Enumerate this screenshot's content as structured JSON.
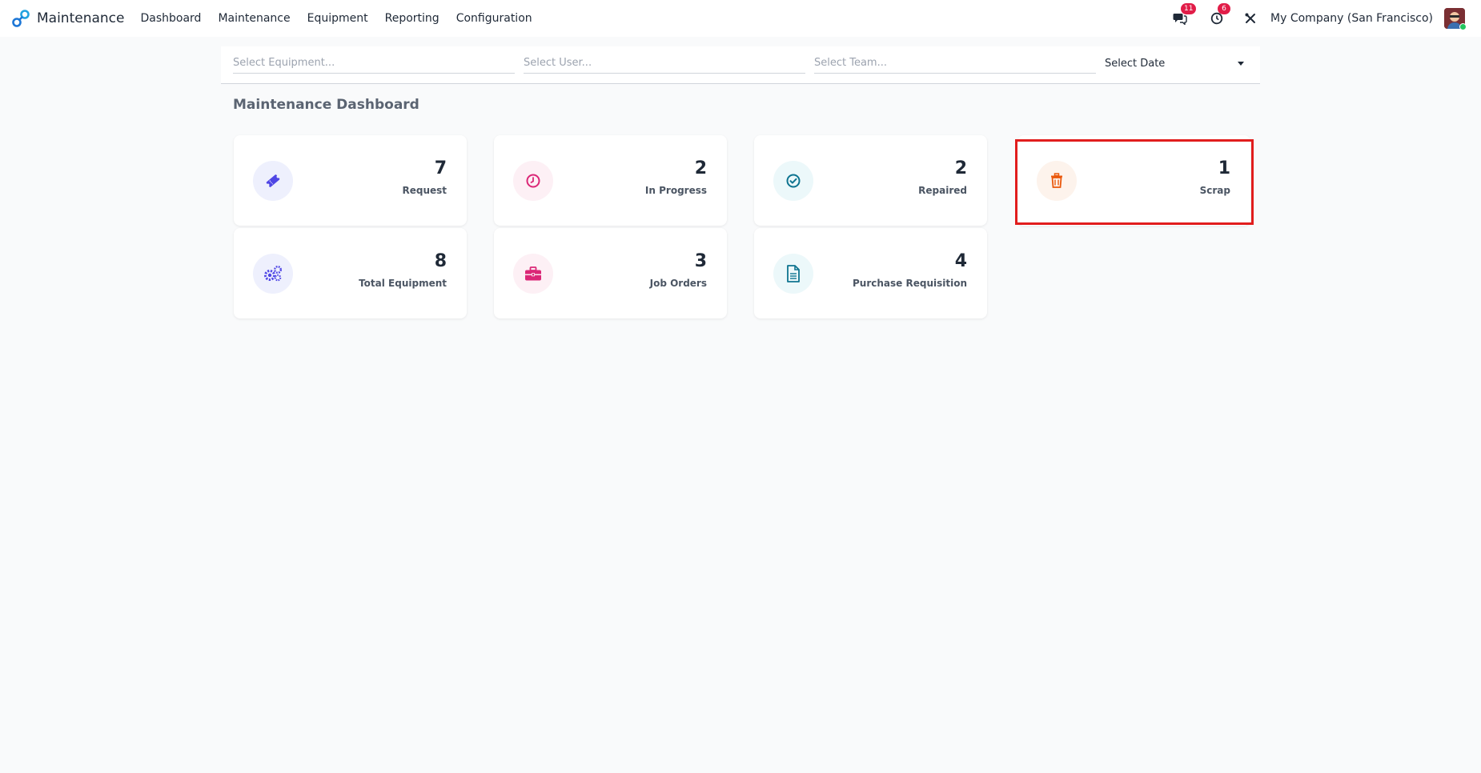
{
  "app": {
    "name": "Maintenance"
  },
  "nav": {
    "items": [
      {
        "label": "Dashboard"
      },
      {
        "label": "Maintenance"
      },
      {
        "label": "Equipment"
      },
      {
        "label": "Reporting"
      },
      {
        "label": "Configuration"
      }
    ],
    "messages_badge": "11",
    "activities_badge": "6",
    "company": "My Company (San Francisco)"
  },
  "filters": {
    "equipment_placeholder": "Select Equipment...",
    "user_placeholder": "Select User...",
    "team_placeholder": "Select Team...",
    "date_label": "Select Date"
  },
  "dashboard": {
    "title": "Maintenance Dashboard",
    "cards": [
      {
        "value": "7",
        "label": "Request",
        "icon": "ticket-icon",
        "color": "#4f46e5",
        "bg": "#eef0fd"
      },
      {
        "value": "2",
        "label": "In Progress",
        "icon": "clock-icon",
        "color": "#db2777",
        "bg": "#fdf0f5"
      },
      {
        "value": "2",
        "label": "Repaired",
        "icon": "check-circle-icon",
        "color": "#0e7490",
        "bg": "#ecf8fa"
      },
      {
        "value": "1",
        "label": "Scrap",
        "icon": "trash-icon",
        "color": "#ea580c",
        "bg": "#fdf3ec"
      },
      {
        "value": "8",
        "label": "Total Equipment",
        "icon": "gears-icon",
        "color": "#4f46e5",
        "bg": "#eef0fd"
      },
      {
        "value": "3",
        "label": "Job Orders",
        "icon": "briefcase-icon",
        "color": "#db2777",
        "bg": "#fdf0f5"
      },
      {
        "value": "4",
        "label": "Purchase Requisition",
        "icon": "document-icon",
        "color": "#0e7490",
        "bg": "#ecf8fa"
      }
    ]
  },
  "colors": {
    "highlight": "#e11d1d",
    "brand": "#1d77d6"
  }
}
